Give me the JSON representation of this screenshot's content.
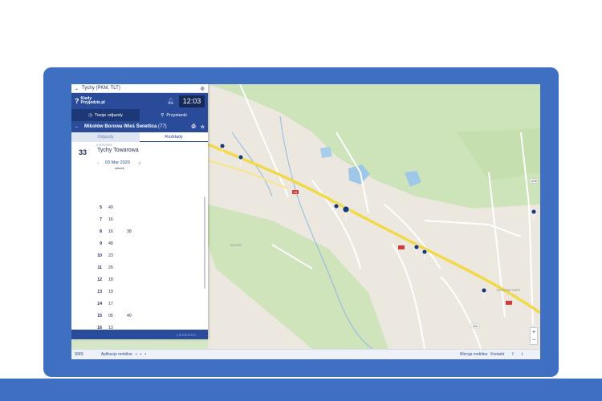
{
  "city_selector": {
    "label": "Tychy (PKM, TLT)"
  },
  "brand": {
    "line1": "Kiedy",
    "line2": "Przyjedzie.pl"
  },
  "clock": "12:03",
  "tabs": {
    "departures": "Twoje odjazdy",
    "stops": "Przystanki"
  },
  "stop": {
    "name": "Mikołów Borowa Wieś Świetlica",
    "count": "(77)"
  },
  "subtabs": {
    "departures": "Odjazdy",
    "schedules": "Rozkłady"
  },
  "direction": {
    "caption": "KIERUNEK",
    "line": "33",
    "destination": "Tychy Towarowa"
  },
  "date": {
    "value": "03 Mar 2020",
    "weekday": "wtorek",
    "prev": "‹",
    "next": "›"
  },
  "timetable": [
    {
      "hour": "5",
      "minutes": [
        "49"
      ]
    },
    {
      "hour": "7",
      "minutes": [
        "16"
      ]
    },
    {
      "hour": "8",
      "minutes": [
        "16",
        "38"
      ]
    },
    {
      "hour": "9",
      "minutes": [
        "48"
      ]
    },
    {
      "hour": "10",
      "minutes": [
        "23"
      ]
    },
    {
      "hour": "11",
      "minutes": [
        "26"
      ]
    },
    {
      "hour": "12",
      "minutes": [
        "18"
      ]
    },
    {
      "hour": "13",
      "minutes": [
        "19"
      ]
    },
    {
      "hour": "14",
      "minutes": [
        "17"
      ]
    },
    {
      "hour": "15",
      "minutes": [
        "06",
        "40"
      ]
    },
    {
      "hour": "16",
      "minutes": [
        "13"
      ]
    }
  ],
  "legend": "LEGENDA",
  "footer": {
    "sms": "SMS",
    "apps": "Aplikacje mobilne",
    "mobile": "Wersja mobilna",
    "contact": "Kontakt"
  },
  "map_labels": {
    "boyer": "BOYER",
    "borowa_wies": "BOROWA WIEŚ",
    "road_44": "44",
    "road_925": "925",
    "road_1025": "1025"
  },
  "zoom": {
    "in": "+",
    "out": "−"
  },
  "colors": {
    "brand": "#2a4b9a",
    "frame": "#3f6fc0",
    "road_major": "#f1d94a",
    "forest": "#cde3b9",
    "water": "#9fc7e8"
  }
}
